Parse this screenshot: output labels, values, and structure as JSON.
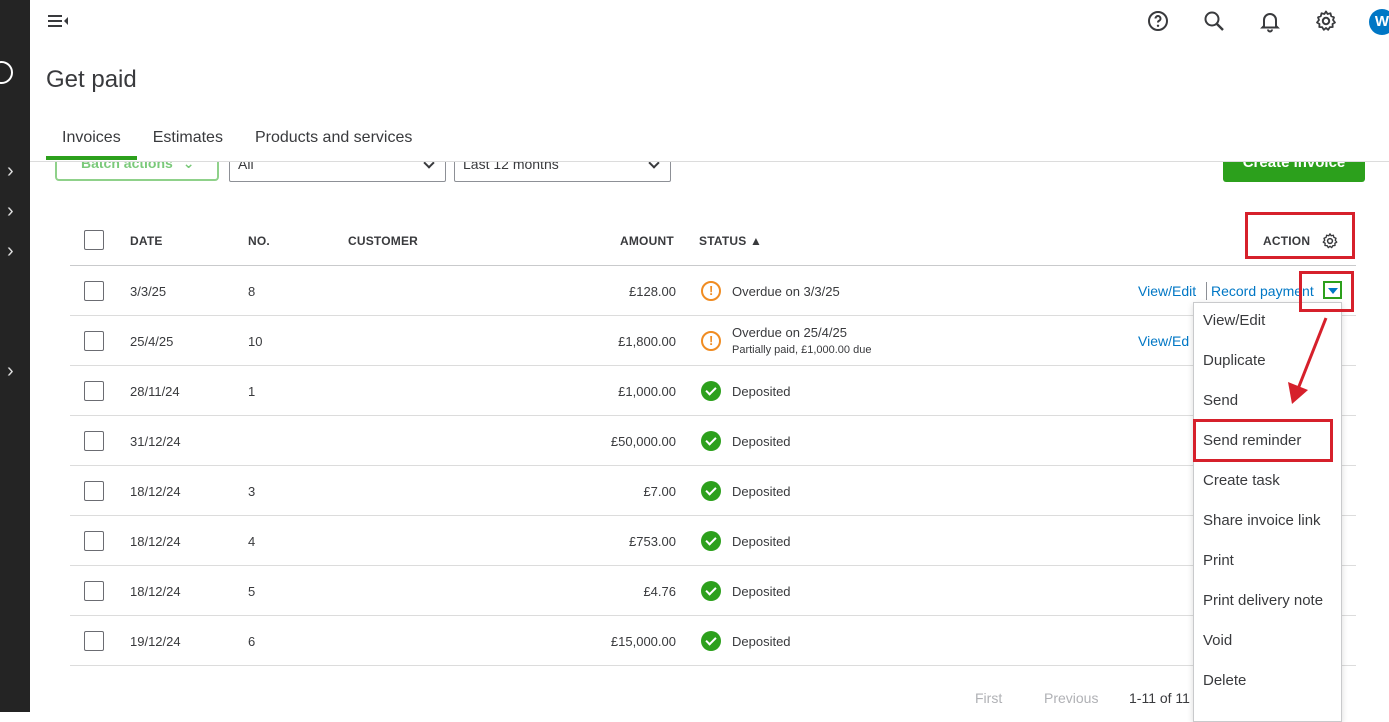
{
  "page": {
    "title": "Get paid"
  },
  "header": {
    "avatar_initial": "W"
  },
  "tabs": [
    {
      "label": "Invoices",
      "active": true
    },
    {
      "label": "Estimates",
      "active": false
    },
    {
      "label": "Products and services",
      "active": false
    }
  ],
  "filters": {
    "batch_actions": "Batch actions",
    "status_value": "All",
    "date_value": "Last 12 months",
    "create_invoice": "Create invoice"
  },
  "table": {
    "headers": {
      "date": "DATE",
      "no": "NO.",
      "customer": "CUSTOMER",
      "amount": "AMOUNT",
      "status": "STATUS ▲",
      "action": "ACTION"
    },
    "rows": [
      {
        "date": "3/3/25",
        "no": "8",
        "amount": "£128.00",
        "status": "Overdue on 3/3/25",
        "status_sub": "",
        "status_type": "warn",
        "view_edit": "View/Edit",
        "record_payment": "Record payment"
      },
      {
        "date": "25/4/25",
        "no": "10",
        "amount": "£1,800.00",
        "status": "Overdue on 25/4/25",
        "status_sub": "Partially paid, £1,000.00 due",
        "status_type": "warn",
        "view_edit": "View/Ed",
        "record_payment": ""
      },
      {
        "date": "28/11/24",
        "no": "1",
        "amount": "£1,000.00",
        "status": "Deposited",
        "status_sub": "",
        "status_type": "ok"
      },
      {
        "date": "31/12/24",
        "no": "",
        "amount": "£50,000.00",
        "status": "Deposited",
        "status_sub": "",
        "status_type": "ok"
      },
      {
        "date": "18/12/24",
        "no": "3",
        "amount": "£7.00",
        "status": "Deposited",
        "status_sub": "",
        "status_type": "ok"
      },
      {
        "date": "18/12/24",
        "no": "4",
        "amount": "£753.00",
        "status": "Deposited",
        "status_sub": "",
        "status_type": "ok"
      },
      {
        "date": "18/12/24",
        "no": "5",
        "amount": "£4.76",
        "status": "Deposited",
        "status_sub": "",
        "status_type": "ok"
      },
      {
        "date": "19/12/24",
        "no": "6",
        "amount": "£15,000.00",
        "status": "Deposited",
        "status_sub": "",
        "status_type": "ok"
      }
    ]
  },
  "action_menu": {
    "items": [
      "View/Edit",
      "Duplicate",
      "Send",
      "Send reminder",
      "Create task",
      "Share invoice link",
      "Print",
      "Print delivery note",
      "Void",
      "Delete"
    ]
  },
  "pager": {
    "first": "First",
    "previous": "Previous",
    "range": "1-11 of 11"
  },
  "colors": {
    "primary_green": "#2ca01c",
    "link_blue": "#0077c5",
    "warning_orange": "#f08c22",
    "highlight_red": "#d6202b"
  }
}
